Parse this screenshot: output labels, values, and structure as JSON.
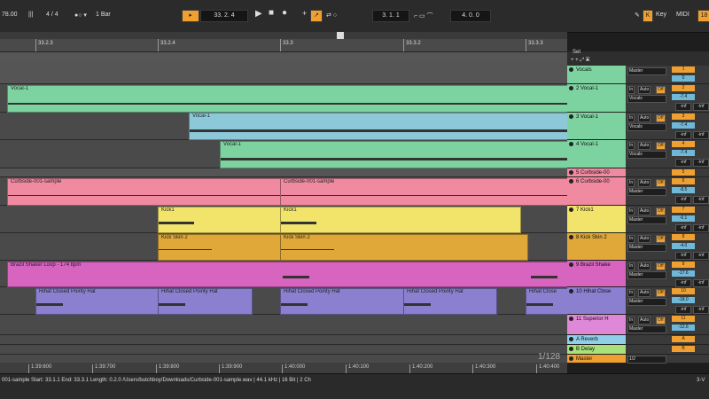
{
  "transport": {
    "tempo": "78.00",
    "signature": "4 / 4",
    "quantize": "1 Bar",
    "position": "33.  2.  4",
    "loop_start": "3.  1.  1",
    "loop_length": "4.  0.  0",
    "key_label": "Key",
    "midi_label": "MIDI",
    "cpu_label": "18"
  },
  "ruler": {
    "ticks": [
      "33.2.3",
      "33.2.4",
      "33.3",
      "33.3.2",
      "33.3.3"
    ]
  },
  "set_label": "Set",
  "clips": {
    "vocal1_a": "Vocal-1",
    "vocal1_b": "Vocal-1",
    "vocal1_c": "Vocal-1",
    "curb_a": "Curbside-001-sample",
    "curb_b": "Curbside-001-sample",
    "kick_a": "Kick1",
    "kick_b": "Kick1",
    "skin_a": "Kick Skin 2",
    "skin_b": "Kick Skin 2",
    "shaker": "Brazil Shaker Loop - 174 bpm",
    "hihat_a": "Hihat Closed Pointy Hat",
    "hihat_b": "Hihat Closed Pointy Hat",
    "hihat_c": "Hihat Closed Pointy Hat",
    "hihat_d": "Hihat Closed Pointy Hat",
    "hihat_e": "Hihat Close"
  },
  "tracks": [
    {
      "name": "Vocals",
      "color": "#7dd3a0"
    },
    {
      "name": "2 Vocal-1",
      "color": "#7dd3a0"
    },
    {
      "name": "3 Vocal-1",
      "color": "#7dd3a0"
    },
    {
      "name": "4 Vocal-1",
      "color": "#7dd3a0"
    },
    {
      "name": "5 Curbside-00",
      "color": "#f08aa0"
    },
    {
      "name": "6 Curbside-00",
      "color": "#f08aa0"
    },
    {
      "name": "7 Kick1",
      "color": "#f2e36a"
    },
    {
      "name": "8 Kick Skin 2",
      "color": "#e0a838"
    },
    {
      "name": "9 Brazil Shake",
      "color": "#d765c0"
    },
    {
      "name": "10 Hihat Close",
      "color": "#8b7fd0"
    },
    {
      "name": "11 Superior H",
      "color": "#e088d8"
    },
    {
      "name": "A Reverb",
      "color": "#8fd0e8"
    },
    {
      "name": "B Delay",
      "color": "#a8e07a"
    },
    {
      "name": "Master",
      "color": "#f0a030"
    }
  ],
  "mixer": {
    "in": "In",
    "auto": "Auto",
    "off": "Off",
    "master": "Master",
    "vocals": "Vocals",
    "half": "1/2",
    "inf": "-inf",
    "rows": [
      {
        "num": "1",
        "vol": "0"
      },
      {
        "num": "2",
        "vol": "-7.4"
      },
      {
        "num": "3",
        "vol": "-7.4"
      },
      {
        "num": "4",
        "vol": "-7.4"
      },
      {
        "num": "5",
        "vol": "0"
      },
      {
        "num": "6",
        "vol": "-8.5"
      },
      {
        "num": "7",
        "vol": "-6.1"
      },
      {
        "num": "8",
        "vol": "-4.0"
      },
      {
        "num": "9",
        "vol": "-17.6"
      },
      {
        "num": "10",
        "vol": "-18.0"
      },
      {
        "num": "11",
        "vol": "-12.6"
      },
      {
        "num": "A",
        "vol": "0"
      },
      {
        "num": "B",
        "vol": "0"
      },
      {
        "num": "",
        "vol": "0"
      }
    ]
  },
  "time_ruler": [
    "1:39:600",
    "1:39:700",
    "1:39:800",
    "1:39:900",
    "1:40:000",
    "1:40:100",
    "1:40:200",
    "1:40:300",
    "1:40:400"
  ],
  "zoom_label": "1/128",
  "status_text": "001-sample  Start: 33.1.1  End: 33.3.1  Length: 0.2.0  /Users/butchboy/Downloads/Curbside-001-sample.wav | 44.1 kHz | 16 Bit | 2 Ch",
  "status_right": "3-V"
}
